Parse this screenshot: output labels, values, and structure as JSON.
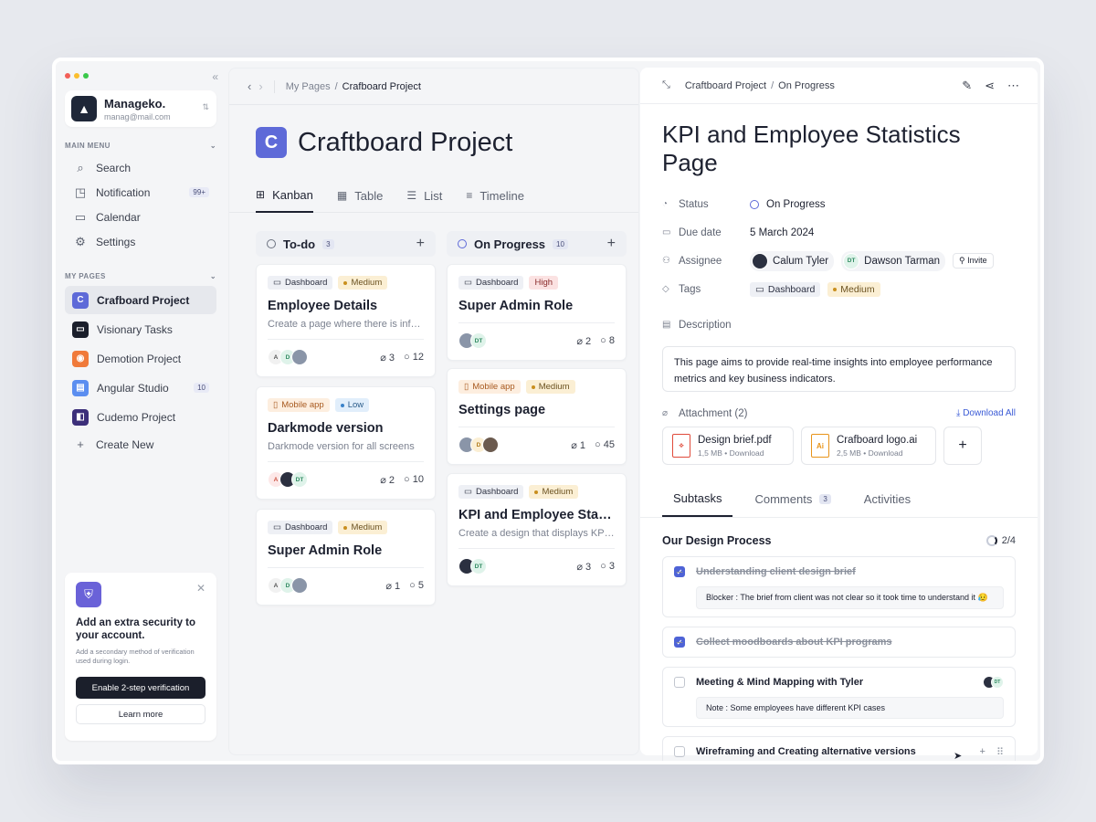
{
  "sidebar": {
    "workspace": {
      "name": "Manageko.",
      "email": "manag@mail.com"
    },
    "main_menu_label": "MAIN MENU",
    "menu": [
      {
        "label": "Search",
        "icon": "search-icon"
      },
      {
        "label": "Notification",
        "icon": "bell-icon",
        "badge": "99+"
      },
      {
        "label": "Calendar",
        "icon": "calendar-icon"
      },
      {
        "label": "Settings",
        "icon": "gear-icon"
      }
    ],
    "my_pages_label": "MY PAGES",
    "pages": [
      {
        "label": "Crafboard Project",
        "letter": "C",
        "color": "#5e6ad8",
        "active": true
      },
      {
        "label": "Visionary Tasks",
        "color": "#1b1f2b"
      },
      {
        "label": "Demotion Project",
        "color": "#f07a3a"
      },
      {
        "label": "Angular Studio",
        "color": "#5b8ef0",
        "badge": "10"
      },
      {
        "label": "Cudemo Project",
        "color": "#3c2f7a"
      }
    ],
    "create_new": "Create New",
    "security": {
      "title": "Add an extra security to your account.",
      "desc": "Add a secondary method of verification used during login.",
      "primary_btn": "Enable 2-step verification",
      "secondary_btn": "Learn more"
    }
  },
  "main": {
    "breadcrumb": {
      "parent": "My Pages",
      "current": "Crafboard Project"
    },
    "title": "Craftboard Project",
    "title_letter": "C",
    "tabs": [
      "Kanban",
      "Table",
      "List",
      "Timeline"
    ],
    "columns": [
      {
        "title": "To-do",
        "count": "3"
      },
      {
        "title": "On Progress",
        "count": "10"
      }
    ],
    "cards": {
      "c1": {
        "tag1": "Dashboard",
        "tag2": "Medium",
        "title": "Employee Details",
        "desc": "Create a page where there is information about the employees",
        "attach": "3",
        "comments": "12"
      },
      "c2": {
        "tag1": "Mobile app",
        "tag2": "Low",
        "title": "Darkmode version",
        "desc": "Darkmode version for all screens",
        "attach": "2",
        "comments": "10"
      },
      "c3": {
        "tag1": "Dashboard",
        "tag2": "Medium",
        "title": "Super Admin Role",
        "attach": "1",
        "comments": "5"
      },
      "c4": {
        "tag1": "Dashboard",
        "tag2": "High",
        "title": "Super Admin Role",
        "attach": "2",
        "comments": "8"
      },
      "c5": {
        "tag1": "Mobile app",
        "tag2": "Medium",
        "title": "Settings page",
        "attach": "1",
        "comments": "45"
      },
      "c6": {
        "tag1": "Dashboard",
        "tag2": "Medium",
        "title": "KPI and Employee Statistics Page",
        "desc": "Create a design that displays KPIs and employee statistics",
        "attach": "3",
        "comments": "3"
      }
    }
  },
  "panel": {
    "breadcrumb": {
      "parent": "Craftboard Project",
      "current": "On Progress"
    },
    "title": "KPI and Employee Statistics Page",
    "props": {
      "status_label": "Status",
      "status": "On Progress",
      "due_label": "Due date",
      "due": "5 March 2024",
      "assignee_label": "Assignee",
      "assignee1": "Calum Tyler",
      "assignee2": "Dawson Tarman",
      "assignee2_initials": "DT",
      "invite": "Invite",
      "tags_label": "Tags",
      "tag1": "Dashboard",
      "tag2": "Medium"
    },
    "description_label": "Description",
    "description": "This page aims to provide real-time insights into employee performance metrics and key business indicators.",
    "attachment_label": "Attachment (2)",
    "download_all": "Download All",
    "files": [
      {
        "name": "Design brief.pdf",
        "size": "1,5 MB",
        "action": "Download",
        "type": "pdf"
      },
      {
        "name": "Crafboard logo.ai",
        "size": "2,5 MB",
        "action": "Download",
        "type": "ai"
      }
    ],
    "tabs": {
      "subtasks": "Subtasks",
      "comments": "Comments",
      "comments_count": "3",
      "activities": "Activities"
    },
    "subtasks_title": "Our Design Process",
    "progress": "2/4",
    "tasks": [
      {
        "label": "Understanding client design brief",
        "done": true,
        "note": "Blocker : The brief from client was not clear so it took time to understand it 😥"
      },
      {
        "label": "Collect moodboards about KPI programs",
        "done": true
      },
      {
        "label": "Meeting & Mind Mapping with Tyler",
        "done": false,
        "note": "Note : Some employees have different KPI cases"
      },
      {
        "label": "Wireframing and Creating alternative versions",
        "done": false
      }
    ]
  },
  "colors": {
    "accent": "#5e6ad8",
    "checkbox": "#4e63d6",
    "dark": "#1b1f2b"
  }
}
